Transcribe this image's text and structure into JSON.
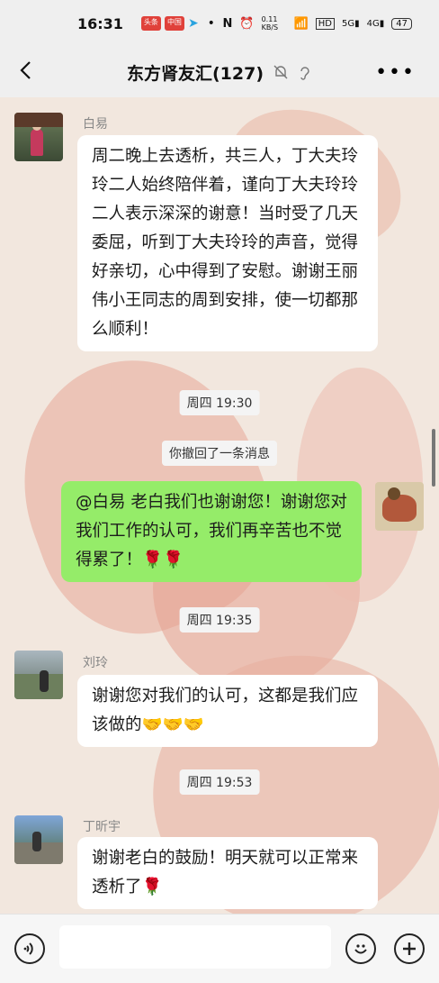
{
  "status": {
    "time": "16:31",
    "badges": [
      "头条",
      "中国"
    ],
    "speed": "0.11 KB/S",
    "battery": "47"
  },
  "header": {
    "title": "东方肾友汇(127)"
  },
  "messages": {
    "m1": {
      "sender": "白易",
      "text": "周二晚上去透析，共三人，丁大夫玲玲二人始终陪伴着，谨向丁大夫玲玲二人表示深深的谢意！当时受了几天委屈，听到丁大夫玲玲的声音，觉得好亲切，心中得到了安慰。谢谢王丽伟小王同志的周到安排，使一切都那么顺利！"
    },
    "t1": "周四 19:30",
    "recall": "你撤回了一条消息",
    "m2": {
      "text": "@白易 老白我们也谢谢您！谢谢您对我们工作的认可，我们再辛苦也不觉得累了！🌹🌹"
    },
    "t2": "周四 19:35",
    "m3": {
      "sender": "刘玲",
      "text": "谢谢您对我们的认可，这都是我们应该做的🤝🤝🤝"
    },
    "t3": "周四 19:53",
    "m4": {
      "sender": "丁昕宇",
      "text": "谢谢老白的鼓励！明天就可以正常来透析了🌹"
    }
  },
  "icons": {
    "back": "back-arrow-icon",
    "mute": "bell-off-icon",
    "ear": "earpiece-icon",
    "more": "more-icon",
    "voice": "voice-icon",
    "emoji": "emoji-icon",
    "plus": "plus-icon"
  },
  "colors": {
    "bubble_self": "#95ec69",
    "bubble_other": "#ffffff",
    "chat_bg": "#f2e7de"
  }
}
